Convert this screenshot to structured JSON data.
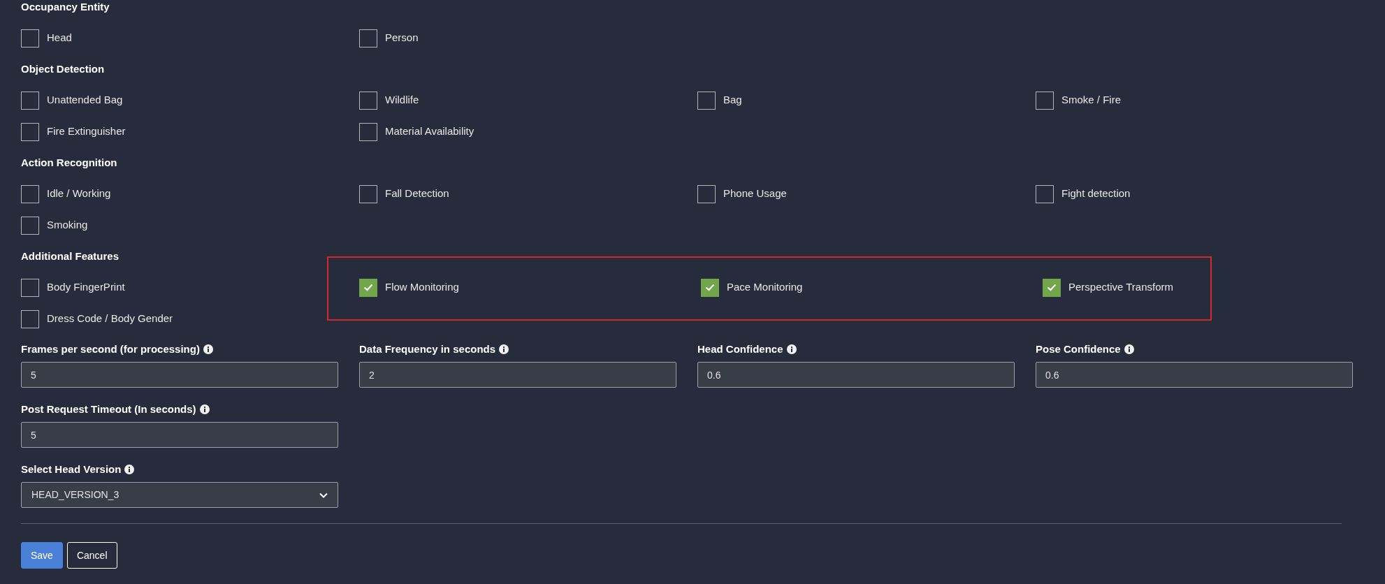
{
  "sections": [
    {
      "title": "Occupancy Entity",
      "items": [
        {
          "label": "Head",
          "checked": false
        },
        {
          "label": "Person",
          "checked": false
        }
      ]
    },
    {
      "title": "Object Detection",
      "items": [
        {
          "label": "Unattended Bag",
          "checked": false
        },
        {
          "label": "Wildlife",
          "checked": false
        },
        {
          "label": "Bag",
          "checked": false
        },
        {
          "label": "Smoke / Fire",
          "checked": false
        },
        {
          "label": "Fire Extinguisher",
          "checked": false
        },
        {
          "label": "Material Availability",
          "checked": false
        }
      ]
    },
    {
      "title": "Action Recognition",
      "items": [
        {
          "label": "Idle / Working",
          "checked": false
        },
        {
          "label": "Fall Detection",
          "checked": false
        },
        {
          "label": "Phone Usage",
          "checked": false
        },
        {
          "label": "Fight detection",
          "checked": false
        },
        {
          "label": "Smoking",
          "checked": false
        }
      ]
    },
    {
      "title": "Additional Features",
      "items": [
        {
          "label": "Body FingerPrint",
          "checked": false
        },
        {
          "label": "Dress Code / Body Gender",
          "checked": false
        }
      ],
      "highlighted_items": [
        {
          "label": "Flow Monitoring",
          "checked": true
        },
        {
          "label": "Pace Monitoring",
          "checked": true
        },
        {
          "label": "Perspective Transform",
          "checked": true
        }
      ]
    }
  ],
  "field_rows": [
    [
      {
        "kind": "input",
        "label": "Frames per second (for processing)",
        "value": "5"
      },
      {
        "kind": "input",
        "label": "Data Frequency in seconds",
        "value": "2"
      },
      {
        "kind": "input",
        "label": "Head Confidence",
        "value": "0.6"
      },
      {
        "kind": "input",
        "label": "Pose Confidence",
        "value": "0.6"
      }
    ],
    [
      {
        "kind": "input",
        "label": "Post Request Timeout (In seconds)",
        "value": "5"
      }
    ],
    [
      {
        "kind": "select",
        "label": "Select Head Version",
        "value": "HEAD_VERSION_3"
      }
    ]
  ],
  "buttons": [
    {
      "label": "Save",
      "kind": "primary"
    },
    {
      "label": "Cancel",
      "kind": "outline"
    }
  ]
}
